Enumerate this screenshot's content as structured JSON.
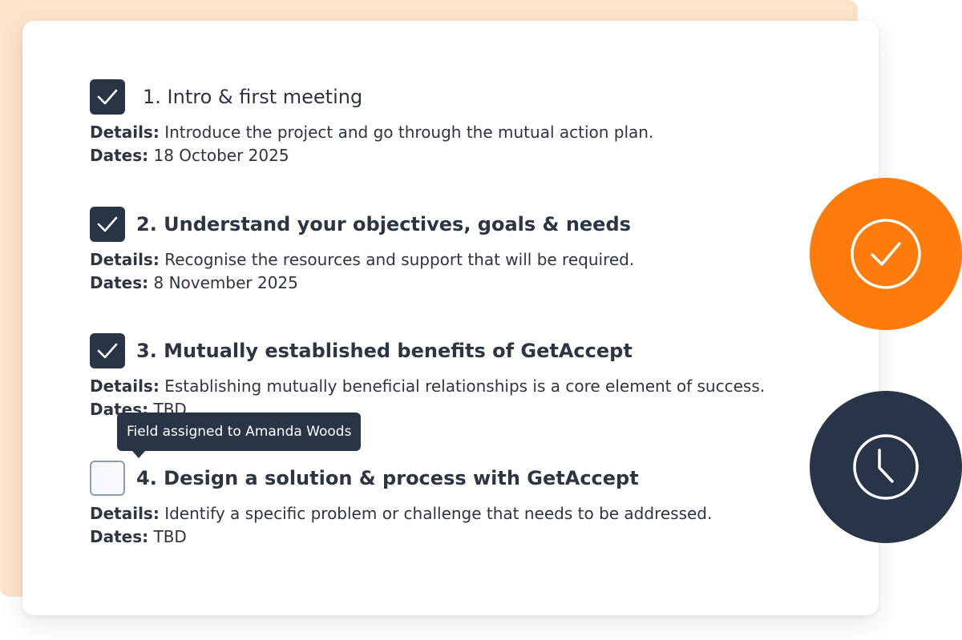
{
  "tooltip": {
    "text": "Field assigned to Amanda Woods"
  },
  "steps": [
    {
      "title": "1. Intro & first meeting",
      "checked": true,
      "details_label": "Details:",
      "details": " Introduce the project and go through the mutual action plan.",
      "dates_label": "Dates:",
      "dates": " 18 October 2025"
    },
    {
      "title": "2. Understand your objectives, goals & needs",
      "checked": true,
      "details_label": "Details:",
      "details": " Recognise the resources and support that will be required.",
      "dates_label": "Dates:",
      "dates": " 8 November 2025"
    },
    {
      "title": "3. Mutually established benefits of GetAccept",
      "checked": true,
      "details_label": "Details:",
      "details": " Establishing mutually beneficial relationships is a core element of success.",
      "dates_label": "Dates:",
      "dates": " TBD"
    },
    {
      "title": "4. Design a solution & process with GetAccept",
      "checked": false,
      "details_label": "Details:",
      "details": " Identify a specific problem or challenge that needs to be addressed.",
      "dates_label": "Dates:",
      "dates": " TBD"
    }
  ],
  "badges": {
    "completed_icon": "check-circle-icon",
    "pending_icon": "clock-icon"
  },
  "colors": {
    "accent_orange": "#ff7c0c",
    "navy": "#283447",
    "peach": "#fde3c9",
    "text": "#2e3542"
  }
}
